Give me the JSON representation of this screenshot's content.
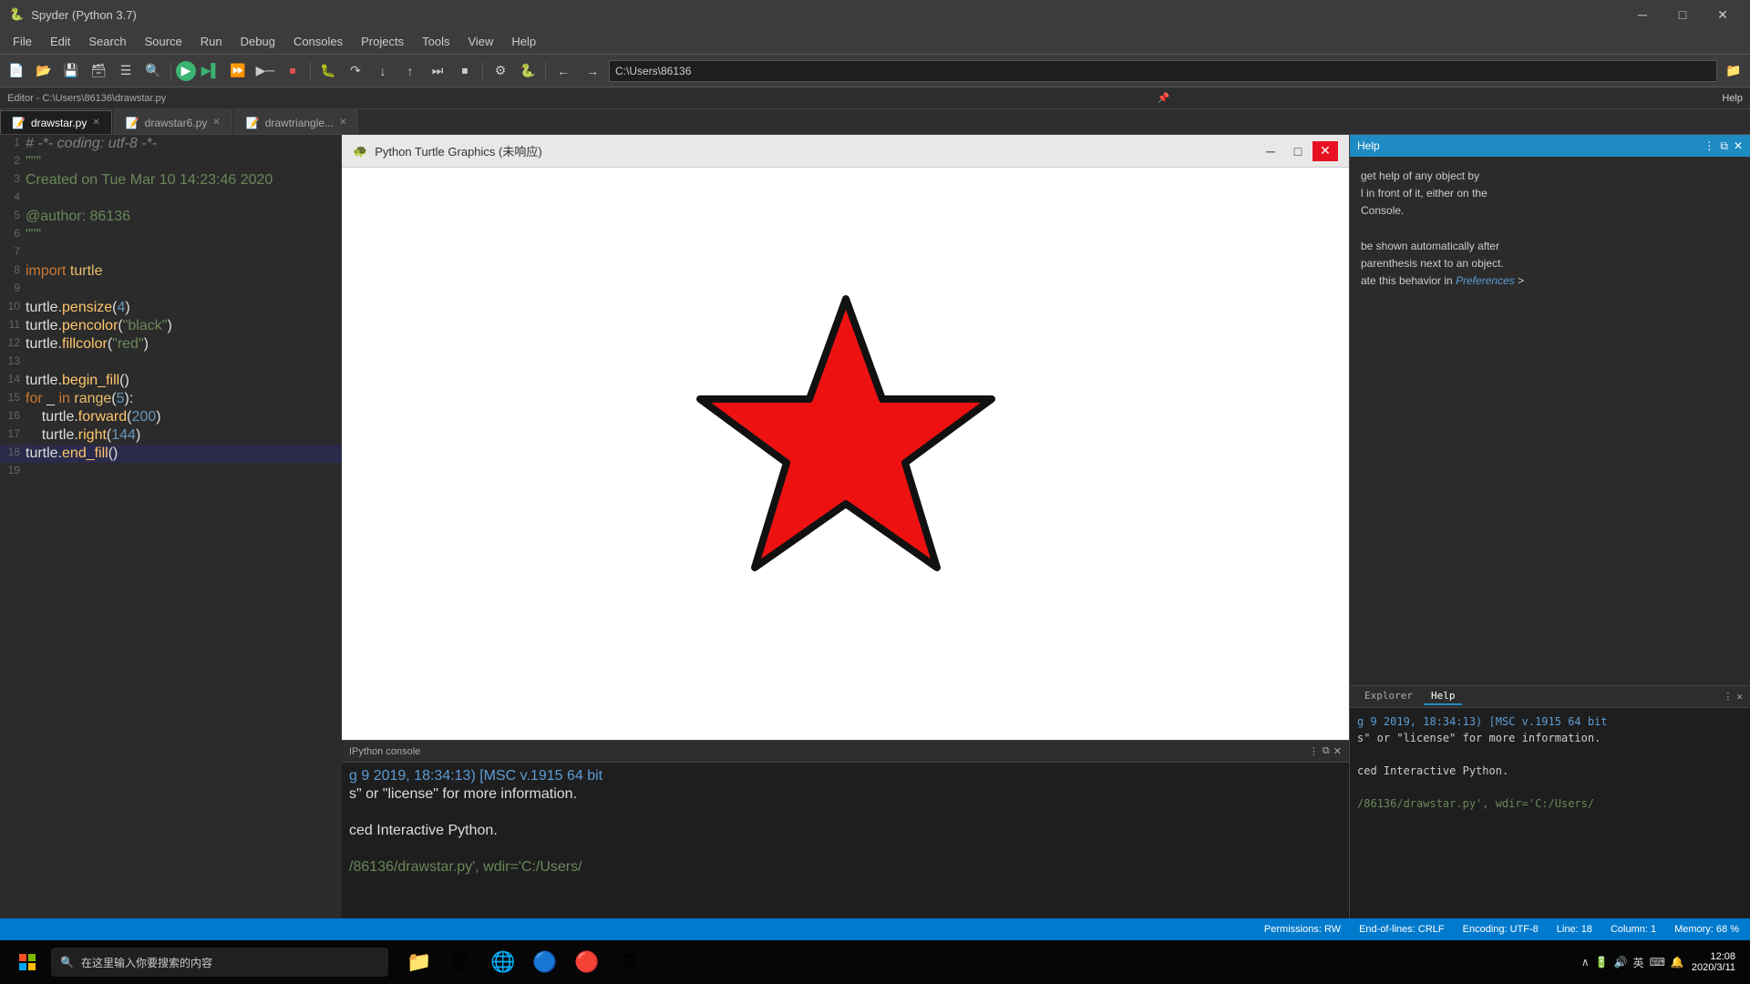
{
  "app": {
    "title": "Spyder (Python 3.7)",
    "spyder_icon": "🐍"
  },
  "menu": {
    "items": [
      "File",
      "Edit",
      "Search",
      "Source",
      "Run",
      "Debug",
      "Consoles",
      "Projects",
      "Tools",
      "View",
      "Help"
    ]
  },
  "editor_header": {
    "label": "Editor - C:\\Users\\86136\\drawstar.py",
    "right_icons": [
      "📌",
      "✕"
    ]
  },
  "tabs": [
    {
      "label": "drawstar.py",
      "active": true,
      "modified": false
    },
    {
      "label": "drawstar6.py",
      "active": false,
      "modified": false
    },
    {
      "label": "drawtriangle...",
      "active": false,
      "modified": false
    }
  ],
  "code_lines": [
    {
      "num": 1,
      "content": "# -*- coding: utf-8 -*-",
      "type": "comment"
    },
    {
      "num": 2,
      "content": "\"\"\"",
      "type": "string"
    },
    {
      "num": 3,
      "content": "Created on Tue Mar 10 14:23:46 2020",
      "type": "string"
    },
    {
      "num": 4,
      "content": "",
      "type": "normal"
    },
    {
      "num": 5,
      "content": "@author: 86136",
      "type": "string"
    },
    {
      "num": 6,
      "content": "\"\"\"",
      "type": "string"
    },
    {
      "num": 7,
      "content": "",
      "type": "normal"
    },
    {
      "num": 8,
      "content": "import turtle",
      "type": "code"
    },
    {
      "num": 9,
      "content": "",
      "type": "normal"
    },
    {
      "num": 10,
      "content": "turtle.pensize(4)",
      "type": "code"
    },
    {
      "num": 11,
      "content": "turtle.pencolor(\"black\")",
      "type": "code"
    },
    {
      "num": 12,
      "content": "turtle.fillcolor(\"red\")",
      "type": "code"
    },
    {
      "num": 13,
      "content": "",
      "type": "normal"
    },
    {
      "num": 14,
      "content": "turtle.begin_fill()",
      "type": "code"
    },
    {
      "num": 15,
      "content": "for _ in range(5):",
      "type": "code"
    },
    {
      "num": 16,
      "content": "    turtle.forward(200)",
      "type": "code",
      "indent": true
    },
    {
      "num": 17,
      "content": "    turtle.right(144)",
      "type": "code",
      "indent": true
    },
    {
      "num": 18,
      "content": "turtle.end_fill()",
      "type": "code",
      "highlighted": true
    },
    {
      "num": 19,
      "content": "",
      "type": "normal"
    }
  ],
  "turtle_window": {
    "title": "Python Turtle Graphics (未响应)",
    "icon": "🐢"
  },
  "help_panel": {
    "title": "Help",
    "header_text": "Help",
    "body": [
      "get help of any object by",
      "l in front of it, either on the",
      "Console.",
      "",
      "be shown automatically after",
      "parenthesis next to an object.",
      "ate this behavior in Preferences >"
    ],
    "tabs": [
      "Explorer",
      "Help"
    ]
  },
  "console": {
    "header": "IPython console",
    "lines": [
      {
        "text": "g 9 2019, 18:34:13) [MSC v.1915 64 bit",
        "color": "blue"
      },
      {
        "text": "s\" or \"license\" for more information.",
        "color": "white"
      },
      {
        "text": "",
        "color": "white"
      },
      {
        "text": "ced Interactive Python.",
        "color": "white"
      },
      {
        "text": "",
        "color": "white"
      },
      {
        "text": "/86136/drawstar.py', wdir='C:/Users/",
        "color": "green"
      }
    ]
  },
  "status_bar": {
    "permissions": "Permissions: RW",
    "eol": "End-of-lines: CRLF",
    "encoding": "Encoding: UTF-8",
    "line": "Line: 18",
    "column": "Column: 1",
    "memory": "Memory: 68 %"
  },
  "taskbar": {
    "search_placeholder": "在这里输入你要搜索的内容",
    "time": "12:08",
    "date": "2020/3/11",
    "lang": "英",
    "apps": [
      "📁",
      "🛍",
      "🌐",
      "🔵",
      "⚙"
    ]
  },
  "path_bar": {
    "back": "←",
    "forward": "→",
    "path": "C:\\Users\\86136"
  }
}
